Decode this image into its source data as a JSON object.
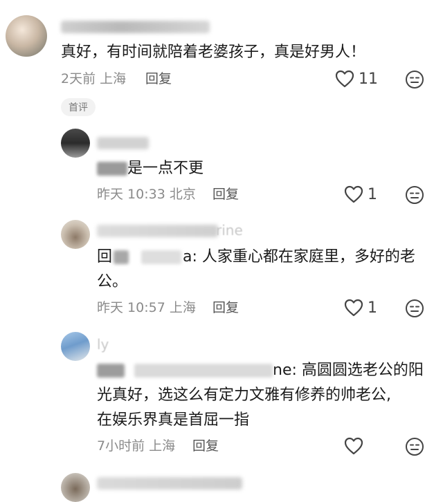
{
  "main_comment": {
    "text": "真好，有时间就陪着老婆孩子，真是好男人！",
    "time_location": "2天前 上海",
    "reply_label": "回复",
    "like_count": "11",
    "badge": "首评"
  },
  "replies": [
    {
      "text": "是一点不更",
      "time_location": "昨天 10:33 北京",
      "reply_label": "回复",
      "like_count": "1"
    },
    {
      "name_visible": "rine",
      "prefix": "回",
      "text_line1": "a: 人家重心都在家庭里，多好的老",
      "text_line2": "公。",
      "time_location": "昨天 10:57 上海",
      "reply_label": "回复",
      "like_count": "1"
    },
    {
      "name_visible": "ly",
      "text_line1": "ne: 高圆圆选老公的阳",
      "text_line2": "光真好，选这么有定力文雅有修养的帅老公,",
      "text_line3": "在娱乐界真是首屈一指",
      "time_location": "7小时前 上海",
      "reply_label": "回复",
      "like_count": ""
    }
  ]
}
